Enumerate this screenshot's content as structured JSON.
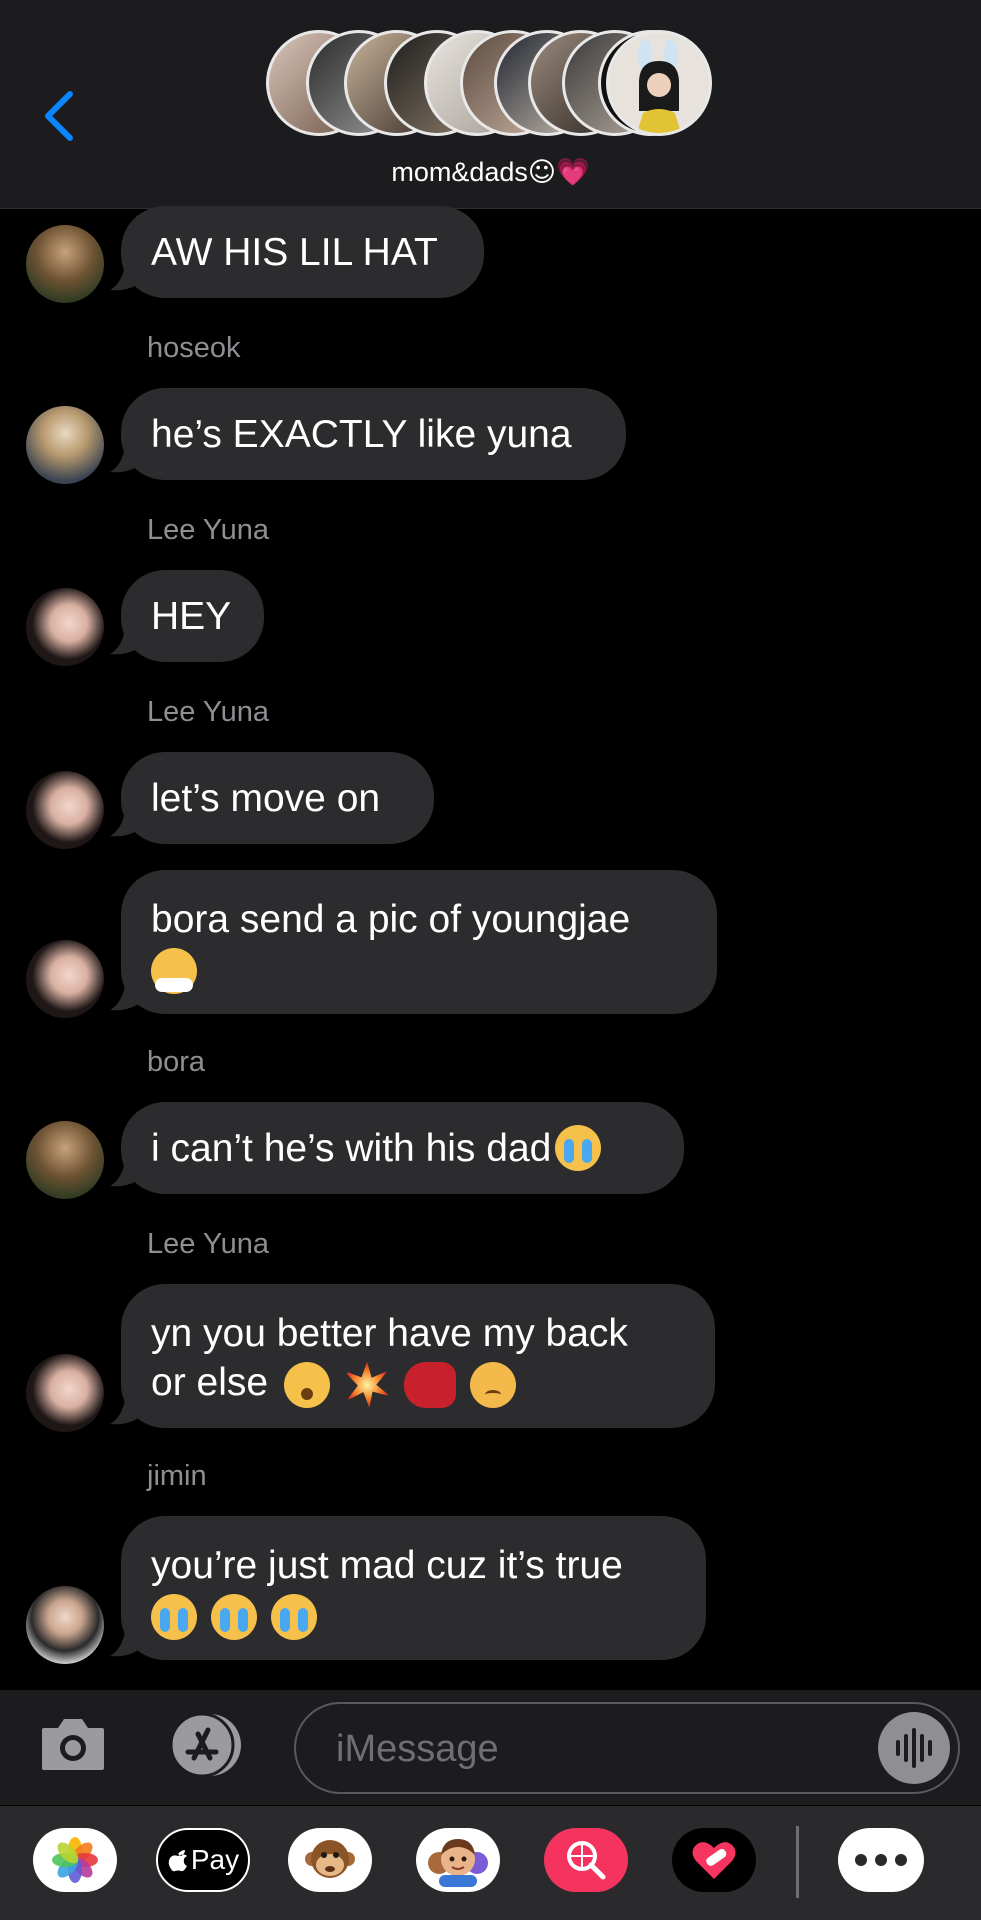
{
  "header": {
    "group_name": "mom&dads",
    "group_emojis": "☺💗"
  },
  "messages": [
    {
      "sender": "",
      "text": "AW HIS LIL HAT"
    },
    {
      "sender": "hoseok",
      "text": "he’s EXACTLY like yuna"
    },
    {
      "sender": "Lee Yuna",
      "text": "HEY"
    },
    {
      "sender": "Lee Yuna",
      "text": "let’s move on"
    },
    {
      "sender": "",
      "text": "bora send a pic of youngjae"
    },
    {
      "sender": "bora",
      "text": "i can’t he’s with his dad"
    },
    {
      "sender": "Lee Yuna",
      "line1": "yn you better have my back",
      "line2": "or else"
    },
    {
      "sender": "jimin",
      "text": "you’re just mad cuz it’s true"
    }
  ],
  "input": {
    "placeholder": "iMessage"
  },
  "drawer": {
    "apple_pay_label": "Pay"
  },
  "icons": {
    "back": "chevron-left-icon",
    "camera": "camera-icon",
    "appstore": "app-store-icon",
    "audio": "waveform-icon",
    "photos": "photos-app-icon",
    "apple_pay": "apple-pay-icon",
    "animoji": "monkey-animoji-icon",
    "memoji": "memoji-icon",
    "search": "web-image-search-icon",
    "digital_touch": "digital-touch-heart-icon",
    "more": "more-apps-icon"
  },
  "colors": {
    "accent": "#0a84ff",
    "bubble": "#2c2c2e",
    "background": "#000000"
  }
}
